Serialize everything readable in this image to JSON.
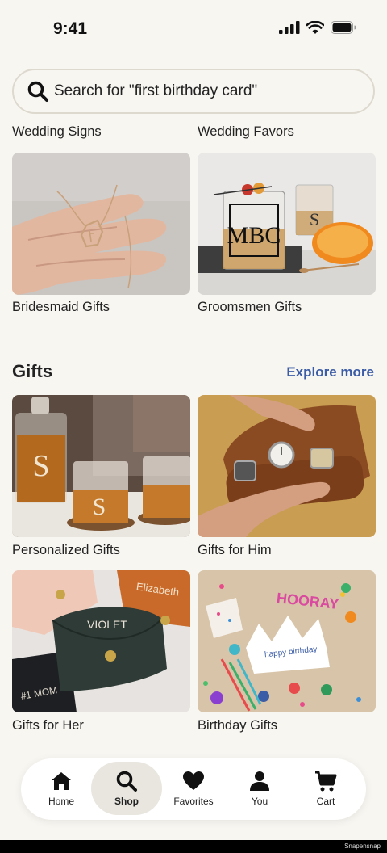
{
  "status_bar": {
    "time": "9:41"
  },
  "search": {
    "placeholder": "Search for \"first birthday card\""
  },
  "top_labels": {
    "left": "Wedding Signs",
    "right": "Wedding Favors"
  },
  "wedding_tiles": [
    {
      "label": "Bridesmaid Gifts"
    },
    {
      "label": "Groomsmen Gifts"
    }
  ],
  "gifts_section": {
    "title": "Gifts",
    "explore": "Explore more",
    "tiles": [
      {
        "label": "Personalized Gifts"
      },
      {
        "label": "Gifts for Him"
      },
      {
        "label": "Gifts for Her"
      },
      {
        "label": "Birthday Gifts"
      }
    ]
  },
  "image_text": {
    "monogram": "MBC",
    "decanter_letter": "S",
    "wallet_name": "VIOLET",
    "wallet_name2": "Elizabeth",
    "wallet_text3": "#1 MOM",
    "birthday_letters": "HOORAY",
    "crown_text": "happy birthday"
  },
  "tabbar": {
    "items": [
      {
        "label": "Home"
      },
      {
        "label": "Shop"
      },
      {
        "label": "Favorites"
      },
      {
        "label": "You"
      },
      {
        "label": "Cart"
      }
    ]
  },
  "footer": {
    "watermark": "Snapensnap"
  },
  "colors": {
    "accent": "#3b5ca6",
    "background": "#f8f6f1"
  }
}
